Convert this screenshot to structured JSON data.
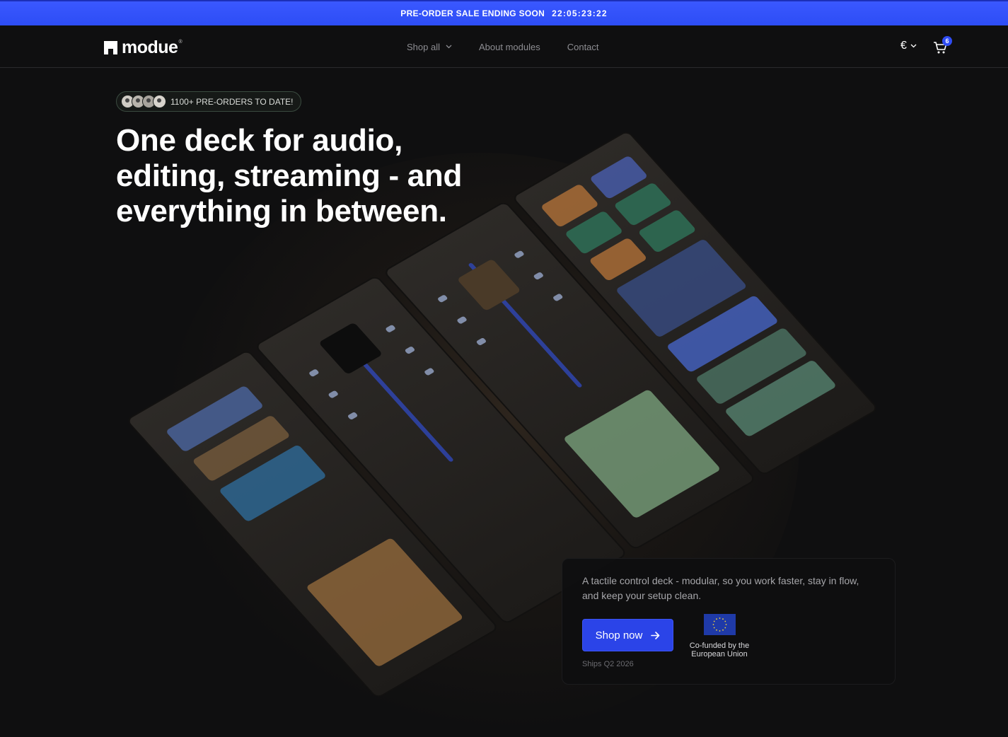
{
  "announcement": {
    "sale_text": "PRE-ORDER SALE ENDING SOON",
    "countdown": "22:05:23:22"
  },
  "header": {
    "logo_text": "modue",
    "logo_sup": "®",
    "nav": [
      {
        "label": "Shop all",
        "has_dropdown": true
      },
      {
        "label": "About modules",
        "has_dropdown": false
      },
      {
        "label": "Contact",
        "has_dropdown": false
      }
    ],
    "currency": "€",
    "cart_count": "6"
  },
  "hero": {
    "preorders_badge": "1100+ PRE-ORDERS TO DATE!",
    "headline": "One deck for audio, editing, streaming - and everything in between.",
    "description": "A tactile control deck - modular, so you work faster, stay in flow, and keep your setup clean.",
    "cta_label": "Shop now",
    "ships_note": "Ships Q2 2026",
    "eu_label": "Co-funded by the European Union"
  },
  "colors": {
    "accent": "#2b44e8",
    "announcement_bg": "#3a58ff",
    "background": "#0f0f10"
  }
}
